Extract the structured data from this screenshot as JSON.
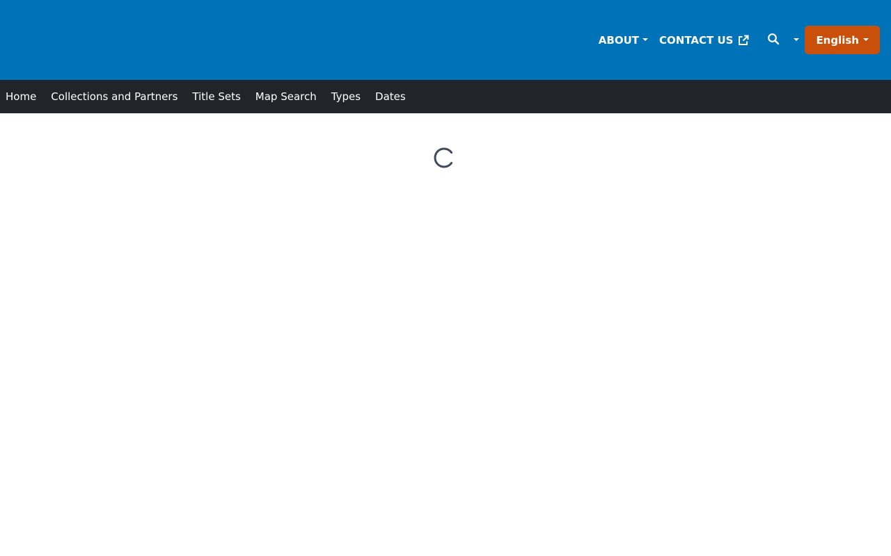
{
  "header": {
    "utility_nav": {
      "about_label": "ABOUT",
      "contact_label": "CONTACT US",
      "language_label": "English"
    }
  },
  "main_nav": {
    "items": [
      {
        "label": "Home"
      },
      {
        "label": "Collections and Partners"
      },
      {
        "label": "Title Sets"
      },
      {
        "label": "Map Search"
      },
      {
        "label": "Types"
      },
      {
        "label": "Dates"
      }
    ]
  },
  "icons": {
    "external": "external-link-icon",
    "search": "search-icon",
    "spinner": "loading-spinner-icon"
  },
  "colors": {
    "header_bg": "#0073b8",
    "nav_bg": "#212529",
    "language_button_bg": "#c9500b",
    "spinner": "#3d4b5c"
  }
}
